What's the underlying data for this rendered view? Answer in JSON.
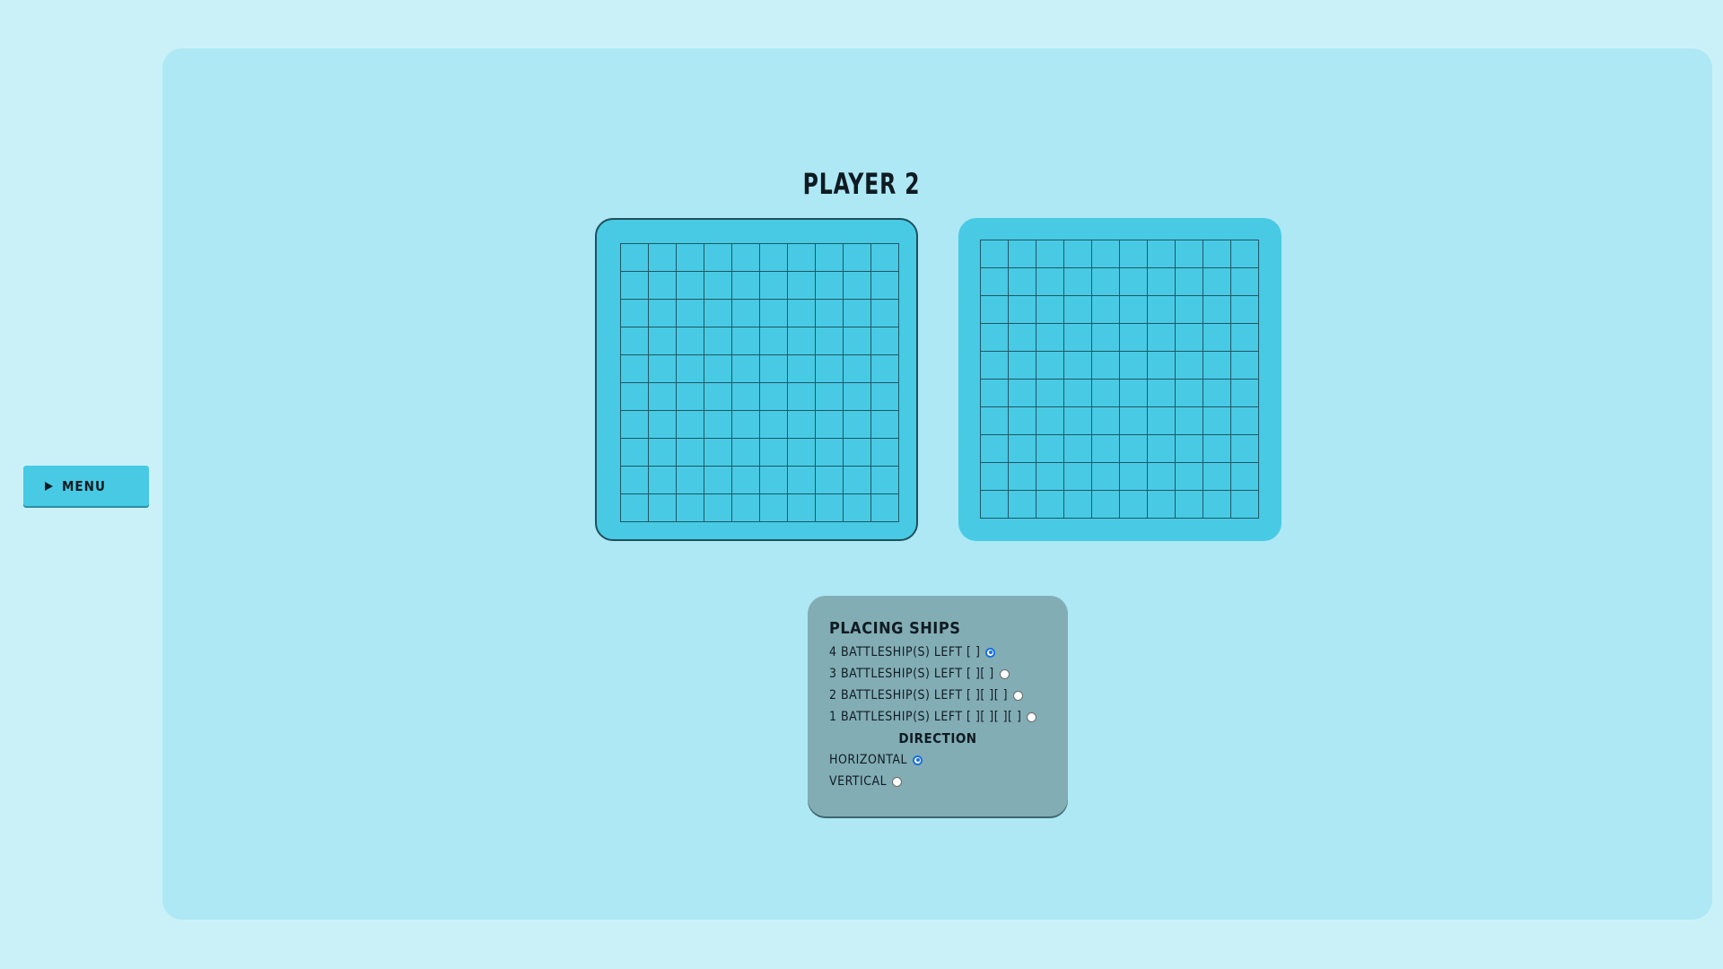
{
  "menu": {
    "label": "MENU",
    "icon": "play-triangle-icon"
  },
  "title": "PLAYER 2",
  "boards": {
    "rows": 10,
    "cols": 10,
    "cell_color": "#48cae4",
    "line_color": "#1f5764"
  },
  "placing": {
    "title": "PLACING SHIPS",
    "ships": [
      {
        "label": "4 BATTLESHIP(S) LEFT [ ]",
        "selected": true
      },
      {
        "label": "3 BATTLESHIP(S) LEFT [ ][ ]",
        "selected": false
      },
      {
        "label": "2 BATTLESHIP(S) LEFT [ ][ ][ ]",
        "selected": false
      },
      {
        "label": "1 BATTLESHIP(S) LEFT [ ][ ][ ][ ]",
        "selected": false
      }
    ],
    "direction_title": "DIRECTION",
    "directions": [
      {
        "label": "HORIZONTAL",
        "selected": true
      },
      {
        "label": "VERTICAL",
        "selected": false
      }
    ]
  },
  "colors": {
    "page_bg": "#cbf1f8",
    "panel_bg": "#ade8f4",
    "accent": "#48cae4",
    "placing_panel_bg": "#83adb5"
  }
}
